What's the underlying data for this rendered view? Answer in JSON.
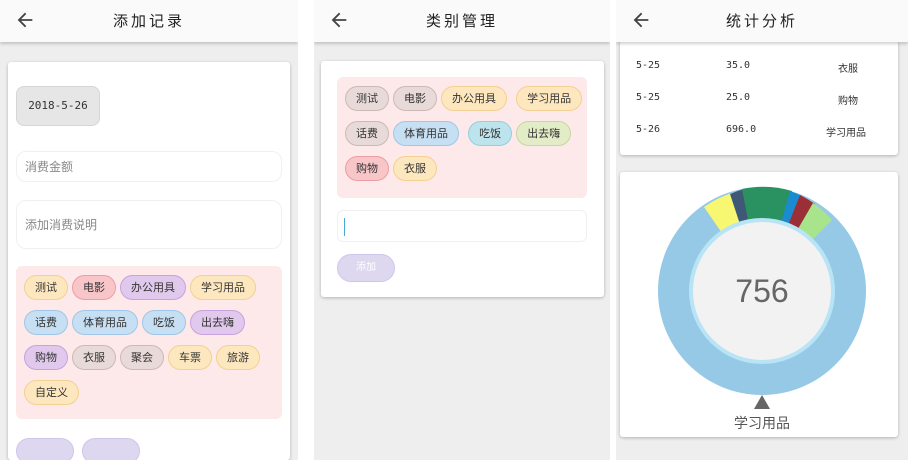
{
  "add_record": {
    "title": "添加记录",
    "date": "2018-5-26",
    "amount_placeholder": "消费金额",
    "desc_placeholder": "添加消费说明",
    "categories": [
      "测试",
      "电影",
      "办公用具",
      "学习用品",
      "话费",
      "体育用品",
      "吃饭",
      "出去嗨",
      "购物",
      "衣服",
      "聚会",
      "车票",
      "旅游",
      "自定义"
    ]
  },
  "category_mgmt": {
    "title": "类别管理",
    "categories": [
      "测试",
      "电影",
      "办公用具",
      "学习用品",
      "话费",
      "体育用品",
      "吃饭",
      "出去嗨",
      "购物",
      "衣服"
    ],
    "add_button": "添加"
  },
  "stats": {
    "title": "统计分析",
    "rows": [
      {
        "date": "5-25",
        "amount": "35.0",
        "category": "衣服"
      },
      {
        "date": "5-25",
        "amount": "25.0",
        "category": "购物"
      },
      {
        "date": "5-26",
        "amount": "696.0",
        "category": "学习用品"
      }
    ],
    "donut_total": "756",
    "selected_label": "学习用品",
    "colors": {
      "study": "#96c9e6",
      "yellow": "#f8f771",
      "navy": "#3e5876",
      "green": "#2a9260",
      "blue": "#1a8bcf",
      "maroon": "#9b2f37",
      "lightgreen": "#a8e48c"
    }
  }
}
